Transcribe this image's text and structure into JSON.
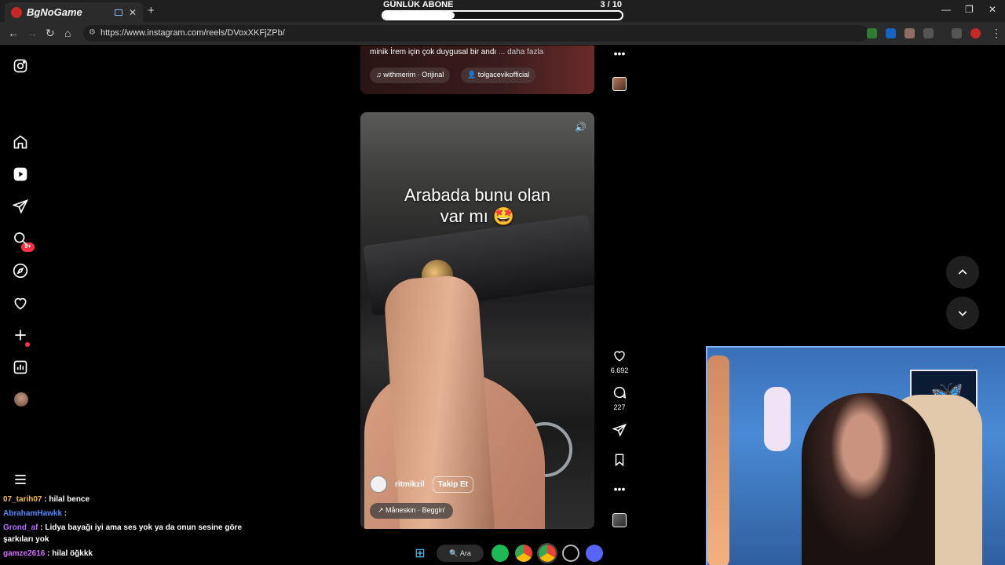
{
  "browser": {
    "tab_title": "BgNoGame",
    "new_tab": "+",
    "url": "https://www.instagram.com/reels/DVoxXKFjZPb/",
    "win_controls": [
      "—",
      "❐",
      "✕"
    ]
  },
  "subscriber_goal": {
    "label": "GÜNLÜK ABONE",
    "count": "3  / 10",
    "progress": 0.3
  },
  "ig_nav": {
    "items": [
      "instagram-logo",
      "home",
      "reels",
      "messages",
      "search",
      "explore",
      "notifications",
      "create",
      "dashboard",
      "profile",
      "more"
    ],
    "messages_badge": "9+"
  },
  "previous_reel": {
    "caption": "minik İrem için çok duygusal bir andı",
    "more_label": "... daha fazla",
    "audio_chip": "withmerim · Orijinal",
    "tag_chip": "tolgacevikofficial"
  },
  "reel": {
    "overlay_text_line1": "Arabada bunu olan",
    "overlay_text_line2": "var mı 🤩",
    "author": "ritmikzil",
    "follow_label": "Takip Et",
    "song": "Måneskin · Beggin'",
    "likes": "6.692",
    "comments": "227"
  },
  "chat": [
    {
      "user": "07_tarih07",
      "user_color": "#f6c04d",
      "text": " : hilal bence"
    },
    {
      "user": "AbrahamHawkk",
      "user_color": "#4f8bff",
      "text": " : "
    },
    {
      "user": "Grond_af",
      "user_color": "#b36bff",
      "text": " : Lidya bayağı iyi ama ses yok ya da onun sesine göre şarkıları yok"
    },
    {
      "user": "gamze2616",
      "user_color": "#d96bff",
      "text": " : hilal öğkkk"
    }
  ],
  "taskbar": {
    "search_label": "Ara"
  },
  "colors": {
    "accent_red": "#ff3040",
    "background": "#000000"
  }
}
